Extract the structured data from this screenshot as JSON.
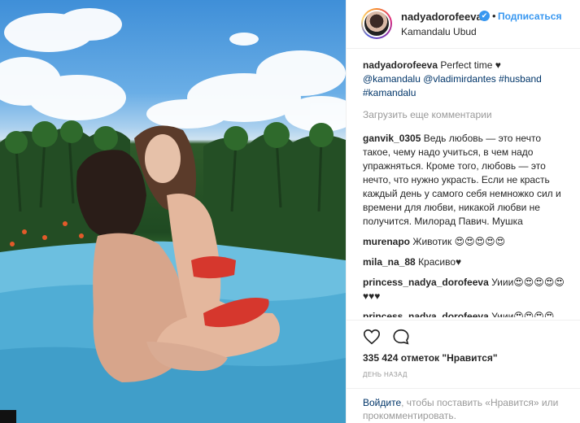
{
  "post": {
    "username": "nadyadorofeeva",
    "verified_badge": "✔",
    "separator": "•",
    "follow_label": "Подписаться",
    "location": "Kamandalu Ubud"
  },
  "caption": {
    "user": "nadyadorofeeva",
    "text": "Perfect time ♥",
    "tags": [
      "@kamandalu",
      "@vladimirdantes",
      "#husband",
      "#kamandalu"
    ]
  },
  "load_more_label": "Загрузить еще комментарии",
  "comments": [
    {
      "user": "ganvik_0305",
      "text": "Ведь любовь — это нечто такое, чему надо учиться, в чем надо упражняться. Кроме того, любовь — это нечто, что нужно украсть. Если не красть каждый день у самого себя немножко сил и времени для любви, никакой любви не получится. Милорад Павич. Мушка"
    },
    {
      "user": "murenapo",
      "text": "Животик 😍😍😍😍😍"
    },
    {
      "user": "mila_na_88",
      "text": "Красиво♥"
    },
    {
      "user": "princess_nadya_dorofeeva",
      "text": "Уиии😍😍😍😍😍♥♥♥"
    },
    {
      "user": "princess_nadya_dorofeeva",
      "text": "Уиии😍😍😍😍"
    }
  ],
  "icons": {
    "like": "heart-icon",
    "comment": "comment-bubble-icon"
  },
  "likes_label": "335 424 отметок \"Нравится\"",
  "timestamp": "ДЕНЬ НАЗАД",
  "footer": {
    "login_link": "Войдите",
    "text_after_link": ", чтобы поставить «Нравится» или прокомментировать."
  },
  "colors": {
    "link_blue": "#3897f0",
    "tag_blue": "#003569",
    "muted": "#999999"
  }
}
